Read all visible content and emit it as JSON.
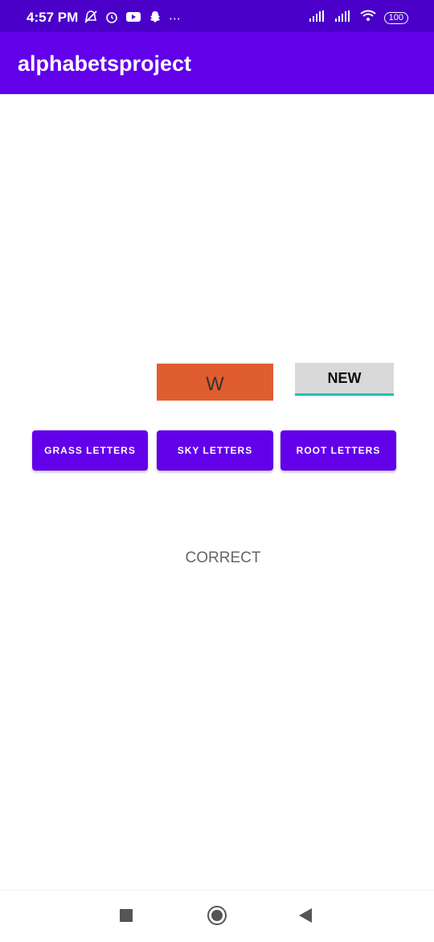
{
  "status_bar": {
    "time": "4:57 PM",
    "icons_left": [
      "notification-off-icon",
      "alarm-icon",
      "youtube-icon",
      "snapchat-icon",
      "more-dots-icon"
    ],
    "icons_right": [
      "signal-icon",
      "signal-icon",
      "wifi-icon"
    ],
    "battery": "100"
  },
  "app_bar": {
    "title": "alphabetsproject"
  },
  "main": {
    "letter": "W",
    "new_button": "NEW",
    "category_buttons": [
      "GRASS LETTERS",
      "SKY LETTERS",
      "ROOT LETTERS"
    ],
    "result": "CORRECT"
  },
  "colors": {
    "status_bar": "#4a00c9",
    "primary": "#6200ea",
    "letter_box": "#e05d30",
    "new_button_bg": "#d9d9d9",
    "new_button_underline": "#23c2b5"
  }
}
